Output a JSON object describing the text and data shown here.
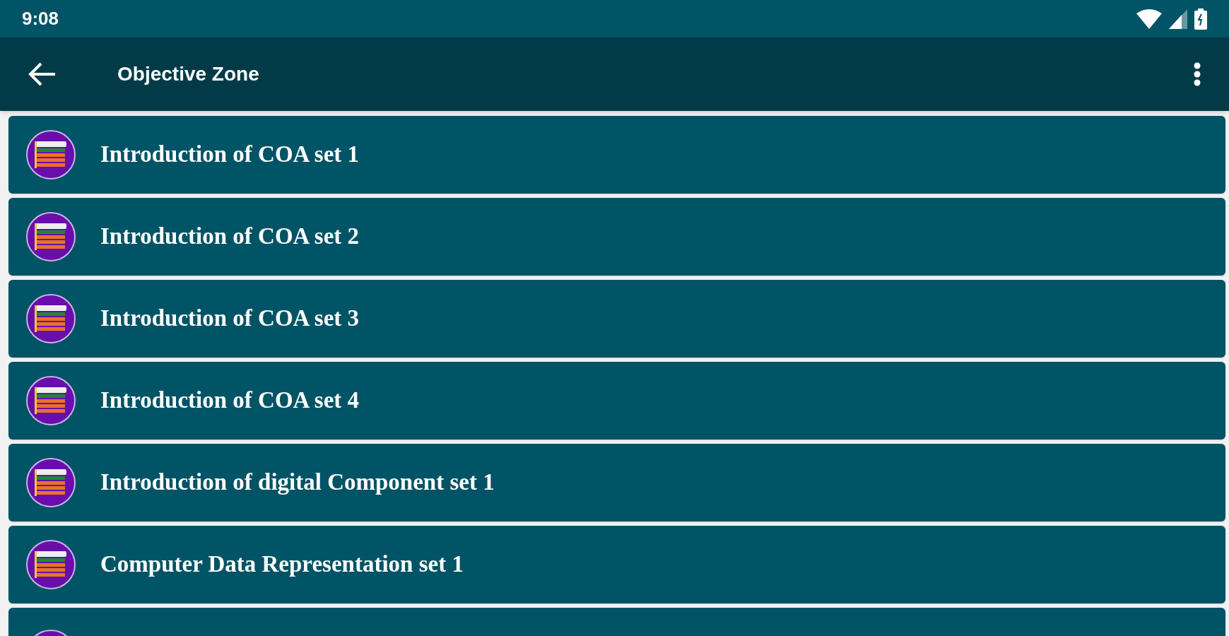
{
  "status_bar": {
    "time": "9:08"
  },
  "app_bar": {
    "title": "Objective Zone"
  },
  "items": [
    {
      "kind": "full",
      "title": "Introduction of COA set 1"
    },
    {
      "kind": "full",
      "title": "Introduction of COA set 2"
    },
    {
      "kind": "full",
      "title": "Introduction of COA set 3"
    },
    {
      "kind": "full",
      "title": "Introduction of COA set 4"
    },
    {
      "kind": "full",
      "title": "Introduction of digital Component set 1"
    },
    {
      "kind": "full",
      "title": "Computer Data Representation set 1"
    },
    {
      "kind": "partial"
    }
  ]
}
